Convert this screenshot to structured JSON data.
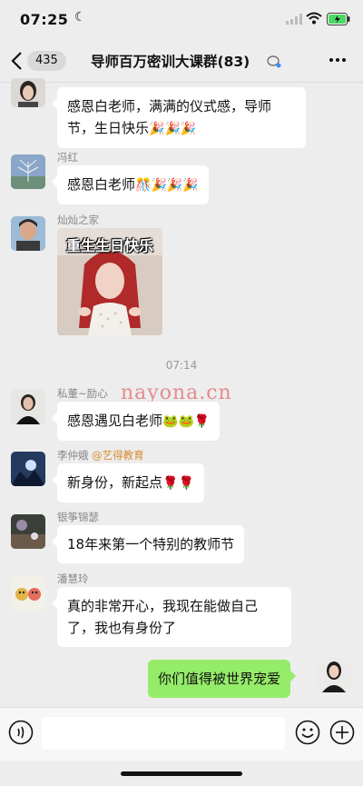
{
  "status": {
    "time": "07:25"
  },
  "header": {
    "unread": "435",
    "title": "导师百万密训大课群(83)"
  },
  "messages": [
    {
      "id": "m1",
      "sender": "",
      "text": "感恩白老师，满满的仪式感，导师",
      "text2": "节，生日快乐",
      "emoji": "🎉🎉🎉"
    },
    {
      "id": "m2",
      "sender": "冯红",
      "text": "感恩白老师",
      "emoji": "🎊🎉🎉🎉"
    },
    {
      "id": "m3",
      "sender": "灿灿之家",
      "sticker_text": "重生生日快乐"
    },
    {
      "id": "ts",
      "timestamp": "07:14"
    },
    {
      "id": "m4",
      "sender": "私董~励心",
      "text": "感恩遇见白老师",
      "emoji": "🐸🐸🌹"
    },
    {
      "id": "m5",
      "sender": "李仲娥",
      "sender_tag": "@艺得教育",
      "text": "新身份，新起点",
      "emoji": "🌹🌹"
    },
    {
      "id": "m6",
      "sender": "银筝锦瑟",
      "text": "18年来第一个特别的教师节"
    },
    {
      "id": "m7",
      "sender": "潘慧玲",
      "text": "真的非常开心，我现在能做自己",
      "text2": "了，我也有身份了"
    },
    {
      "id": "m8",
      "sender": "",
      "text": "你们值得被世界宠爱",
      "self": true
    }
  ],
  "watermark": "nayona.cn",
  "icons": {
    "back": "chevron-left-icon",
    "more": "more-dots-icon",
    "voice": "voice-icon",
    "emoji": "emoji-icon",
    "plus": "plus-icon"
  },
  "colors": {
    "background": "#ededed",
    "self_bubble": "#95ec69",
    "other_bubble": "#ffffff"
  }
}
